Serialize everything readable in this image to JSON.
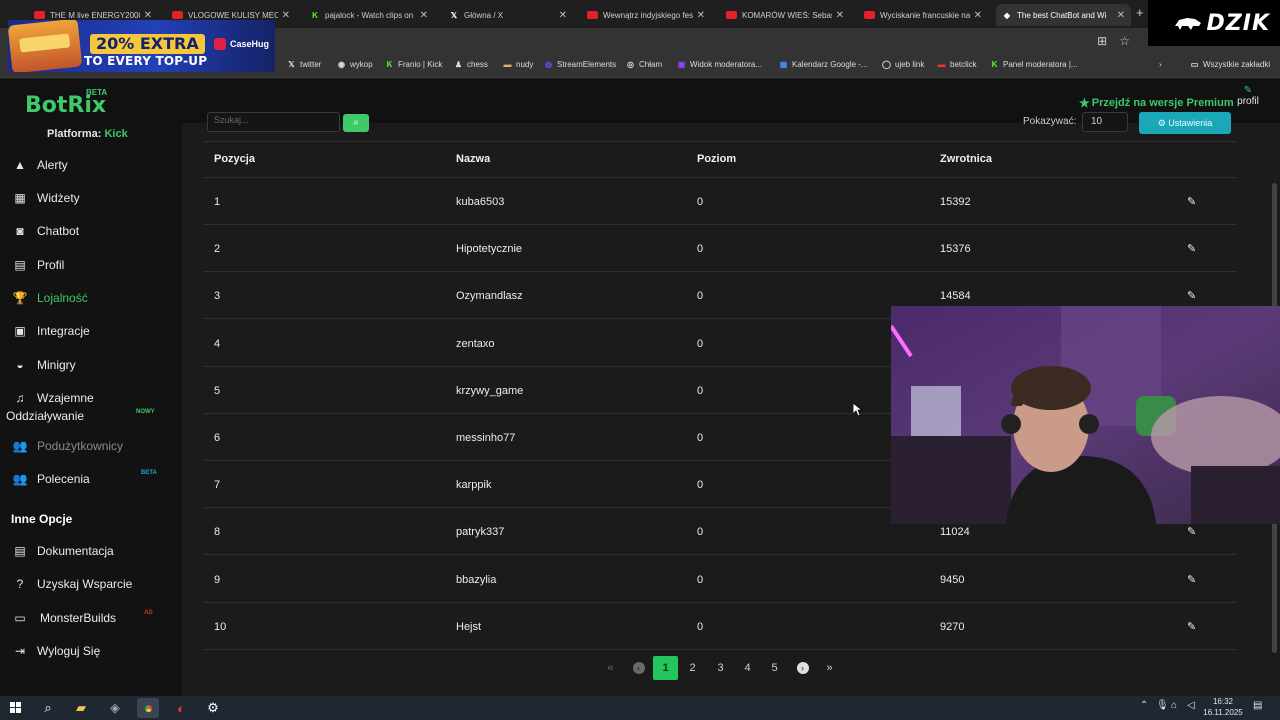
{
  "browser": {
    "tabs": [
      {
        "title": "THE M live ENERGY2000 |",
        "icon": "youtube-icon"
      },
      {
        "title": "VLOGOWE KULISY MECZU",
        "icon": "youtube-icon"
      },
      {
        "title": "pajalock - Watch clips on",
        "icon": "kick-icon"
      },
      {
        "title": "Główna / X",
        "icon": "x-icon"
      },
      {
        "title": "Wewnątrz indyjskiego fes",
        "icon": "youtube-icon"
      },
      {
        "title": "KOMARÓW WIEŚ: Sebasti",
        "icon": "youtube-icon"
      },
      {
        "title": "Wyciskanie francuskie na",
        "icon": "youtube-icon"
      },
      {
        "title": "The best ChatBot and Wi",
        "icon": "botrix-icon"
      }
    ],
    "new_tab": "+",
    "bookmarks": [
      {
        "label": "twitter",
        "icon": "x-icon"
      },
      {
        "label": "wykop",
        "icon": "wykop-icon"
      },
      {
        "label": "Franio | Kick",
        "icon": "kick-icon"
      },
      {
        "label": "chess",
        "icon": "chess-icon"
      },
      {
        "label": "nudy",
        "icon": "folder-icon"
      },
      {
        "label": "StreamElements",
        "icon": "streamelements-icon"
      },
      {
        "label": "Chłam",
        "icon": "globe-icon"
      },
      {
        "label": "Widok moderatora...",
        "icon": "twitch-icon"
      },
      {
        "label": "Kalendarz Google -...",
        "icon": "calendar-icon"
      },
      {
        "label": "ujeb link",
        "icon": "link-icon"
      },
      {
        "label": "betclick",
        "icon": "bet-icon"
      },
      {
        "label": "Panel moderatora |...",
        "icon": "kick-icon"
      }
    ],
    "bookmarks_overflow": "›",
    "all_bookmarks": "Wszystkie zakładki"
  },
  "ad": {
    "line1": "20% EXTRA",
    "line2": "TO EVERY TOP-UP",
    "brand": "CaseHug"
  },
  "overlay_logo": "DZIK",
  "app": {
    "logo": "BotRix",
    "beta": "BETA",
    "premium": "Przejdź na wersje Premium",
    "profile": "profil",
    "platform_label": "Platforma:",
    "platform_value": "Kick"
  },
  "sidebar": {
    "items": [
      {
        "label": "Alerty",
        "icon": "alert-icon"
      },
      {
        "label": "Widżety",
        "icon": "widgets-icon"
      },
      {
        "label": "Chatbot",
        "icon": "robot-icon"
      },
      {
        "label": "Profil",
        "icon": "profile-card-icon"
      },
      {
        "label": "Lojalność",
        "icon": "trophy-icon",
        "active": true
      },
      {
        "label": "Integracje",
        "icon": "integration-icon"
      },
      {
        "label": "Minigry",
        "icon": "gamepad-icon"
      },
      {
        "label": "Wzajemne",
        "label2": "Oddziaływanie",
        "icon": "music-icon",
        "badge": "NOWY"
      },
      {
        "label": "Podużytkownicy",
        "icon": "users-icon",
        "muted": true
      },
      {
        "label": "Polecenia",
        "icon": "referral-icon",
        "badge": "BETA"
      }
    ],
    "section_title": "Inne Opcje",
    "other": [
      {
        "label": "Dokumentacja",
        "icon": "docs-icon"
      },
      {
        "label": "Uzyskaj Wsparcie",
        "icon": "help-icon"
      },
      {
        "label": "MonsterBuilds",
        "icon": "laptop-icon",
        "badge": "AD"
      },
      {
        "label": "Wyloguj Się",
        "icon": "logout-icon"
      }
    ]
  },
  "toolbar": {
    "search_placeholder": "Szukaj...",
    "show_label": "Pokazywać:",
    "show_value": "10",
    "settings_button": "Ustawienia"
  },
  "table": {
    "columns": [
      "Pozycja",
      "Nazwa",
      "Poziom",
      "Zwrotnica"
    ],
    "rows": [
      {
        "pos": "1",
        "name": "kuba6503",
        "level": "0",
        "points": "15392"
      },
      {
        "pos": "2",
        "name": "Hipotetycznie",
        "level": "0",
        "points": "15376"
      },
      {
        "pos": "3",
        "name": "Ozymandlasz",
        "level": "0",
        "points": "14584"
      },
      {
        "pos": "4",
        "name": "zentaxo",
        "level": "0",
        "points": ""
      },
      {
        "pos": "5",
        "name": "krzywy_game",
        "level": "0",
        "points": ""
      },
      {
        "pos": "6",
        "name": "messinho77",
        "level": "0",
        "points": ""
      },
      {
        "pos": "7",
        "name": "karppik",
        "level": "0",
        "points": ""
      },
      {
        "pos": "8",
        "name": "patryk337",
        "level": "0",
        "points": "11024"
      },
      {
        "pos": "9",
        "name": "bbazylia",
        "level": "0",
        "points": "9450"
      },
      {
        "pos": "10",
        "name": "Hejst",
        "level": "0",
        "points": "9270"
      }
    ]
  },
  "pagination": {
    "first": "«",
    "prev": "‹",
    "pages": [
      "1",
      "2",
      "3",
      "4",
      "5"
    ],
    "current": "1",
    "next": "›",
    "last": "»"
  },
  "taskbar": {
    "time": "16:32",
    "date": "16.11.2025"
  }
}
